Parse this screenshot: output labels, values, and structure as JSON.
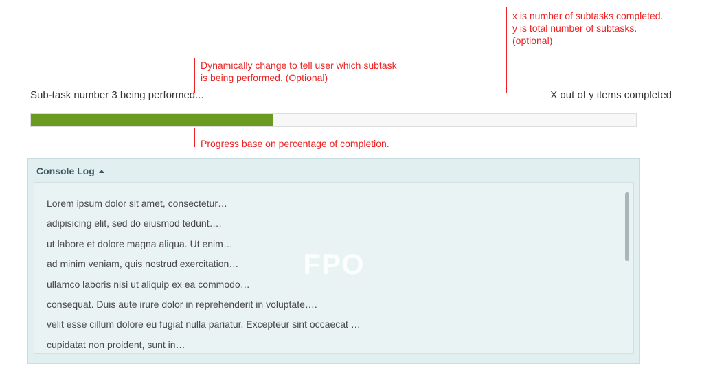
{
  "annotations": {
    "top_right_line1": "x is number of subtasks completed.",
    "top_right_line2": "y is total number of subtasks.",
    "top_right_line3": "(optional)",
    "mid_left_line1": "Dynamically change to tell user which subtask",
    "mid_left_line2": "is being performed. (Optional)",
    "progress_note": "Progress base on percentage of completion."
  },
  "status": {
    "left": "Sub-task number 3 being performed...",
    "right": "X out of y items completed"
  },
  "progress": {
    "percent": 40
  },
  "console": {
    "header": "Console Log",
    "watermark": "FPO",
    "lines": [
      "Lorem ipsum dolor sit amet, consectetur…",
      "adipisicing elit, sed do eiusmod tedunt….",
      "ut labore et dolore magna aliqua. Ut enim…",
      "ad minim veniam, quis nostrud exercitation…",
      "ullamco laboris nisi ut aliquip ex ea commodo…",
      "consequat. Duis aute irure dolor in reprehenderit in voluptate….",
      "velit esse cillum dolore eu fugiat nulla pariatur. Excepteur sint occaecat …",
      "cupidatat non proident, sunt in…"
    ]
  }
}
